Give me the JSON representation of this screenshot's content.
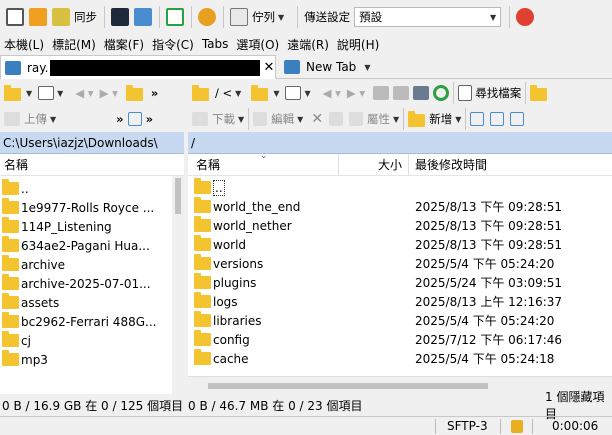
{
  "toolbar": {
    "sync_label": "同步",
    "queue_label": "佇列",
    "transfer_settings_label": "傳送設定",
    "preset_value": "預設"
  },
  "menu": [
    "本機(L)",
    "標記(M)",
    "檔案(F)",
    "指令(C)",
    "Tabs",
    "選項(O)",
    "遠端(R)",
    "說明(H)"
  ],
  "tabs": {
    "session_tab": "ray.",
    "new_tab": "New Tab"
  },
  "local_toolbar": {
    "upload_label": "上傳"
  },
  "remote_toolbar": {
    "path_combo": "/ <",
    "download_label": "下載",
    "edit_label": "編輯",
    "properties_label": "屬性",
    "new_label": "新增",
    "find_files_label": "尋找檔案"
  },
  "local": {
    "path": "C:\\Users\\iazjz\\Downloads\\",
    "col_name": "名稱",
    "up_item": "..",
    "items": [
      "1e9977-Rolls Royce ...",
      "114P_Listening",
      "634ae2-Pagani Hua...",
      "archive",
      "archive-2025-07-01...",
      "assets",
      "bc2962-Ferrari 488G...",
      "cj",
      "mp3"
    ],
    "status": "0 B / 16.9 GB 在 0 / 125 個項目"
  },
  "remote": {
    "path": "/",
    "col_name": "名稱",
    "col_size": "大小",
    "col_modified": "最後修改時間",
    "up_item": "..",
    "items": [
      {
        "name": "world_the_end",
        "modified": "2025/8/13 下午 09:28:51"
      },
      {
        "name": "world_nether",
        "modified": "2025/8/13 下午 09:28:51"
      },
      {
        "name": "world",
        "modified": "2025/8/13 下午 09:28:51"
      },
      {
        "name": "versions",
        "modified": "2025/5/4 下午 05:24:20"
      },
      {
        "name": "plugins",
        "modified": "2025/5/24 下午 03:09:51"
      },
      {
        "name": "logs",
        "modified": "2025/8/13 上午 12:16:37"
      },
      {
        "name": "libraries",
        "modified": "2025/5/4 下午 05:24:20"
      },
      {
        "name": "config",
        "modified": "2025/7/12 下午 06:17:46"
      },
      {
        "name": "cache",
        "modified": "2025/5/4 下午 05:24:18"
      }
    ],
    "status": "0 B / 46.7 MB 在 0 / 23 個項目",
    "hidden_status": "1 個隱藏項目"
  },
  "statusbar": {
    "protocol": "SFTP-3",
    "timer": "0:00:06"
  },
  "colors": {
    "path_bg": "#c6d9f0",
    "folder": "#f4c430",
    "accent": "#0078d7"
  }
}
